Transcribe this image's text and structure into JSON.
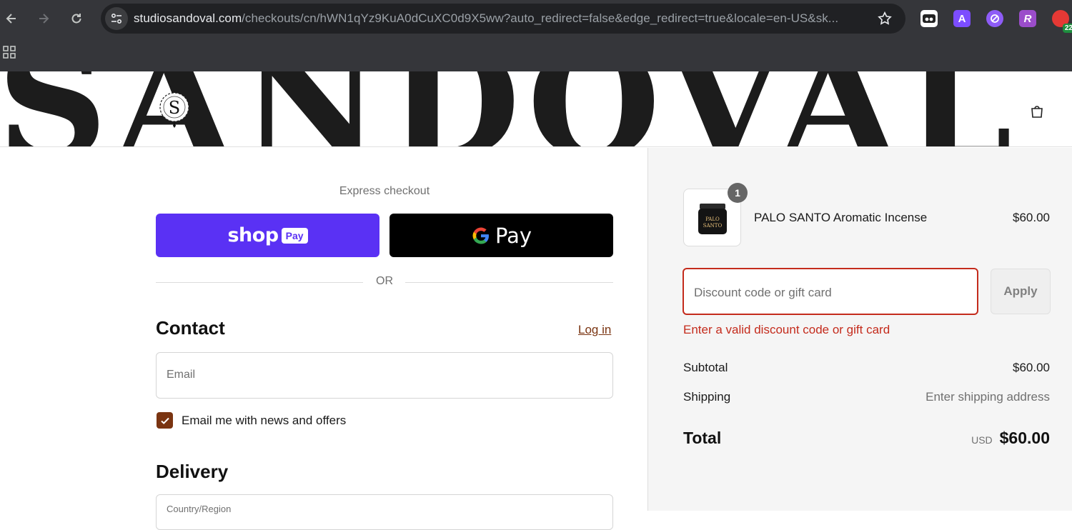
{
  "browser": {
    "url_main": "studiosandoval.com",
    "url_rest": "/checkouts/cn/hWN1qYz9KuA0dCuXC0d9X5ww?auto_redirect=false&edge_redirect=true&locale=en-US&sk...",
    "extensions": [
      {
        "name": "reader-mode-extension",
        "glyph": "◉",
        "color": "#ffffff"
      },
      {
        "name": "a-extension",
        "glyph": "A",
        "color": "#7c4dff"
      },
      {
        "name": "link-extension",
        "glyph": "⊘",
        "color": "#8e5cf7"
      },
      {
        "name": "r-extension",
        "glyph": "R",
        "color": "#9b4dca"
      },
      {
        "name": "badge-extension",
        "glyph": "●",
        "color": "#e53935",
        "badge": "22"
      }
    ]
  },
  "header": {
    "banner_text": "SANDOVAL",
    "logo_letter": "S"
  },
  "express": {
    "label": "Express checkout",
    "shop_pay": {
      "word": "shop",
      "pill": "Pay"
    },
    "gpay": {
      "letter": "G",
      "word": "Pay"
    },
    "or_text": "OR"
  },
  "contact": {
    "title": "Contact",
    "login_link": "Log in",
    "email_placeholder": "Email",
    "newsletter_label": "Email me with news and offers",
    "newsletter_checked": true
  },
  "delivery": {
    "title": "Delivery",
    "country_label": "Country/Region"
  },
  "summary": {
    "product": {
      "name": "PALO SANTO Aromatic Incense",
      "price": "$60.00",
      "quantity": "1",
      "jar_label_line1": "PALO",
      "jar_label_line2": "SANTO"
    },
    "discount": {
      "placeholder": "Discount code or gift card",
      "apply_label": "Apply",
      "error": "Enter a valid discount code or gift card"
    },
    "subtotal_label": "Subtotal",
    "subtotal_value": "$60.00",
    "shipping_label": "Shipping",
    "shipping_value": "Enter shipping address",
    "total_label": "Total",
    "currency": "USD",
    "total_value": "$60.00"
  },
  "colors": {
    "shop_pay": "#5a31f4",
    "accent_brown": "#7a3411",
    "error_red": "#c42b1c"
  }
}
